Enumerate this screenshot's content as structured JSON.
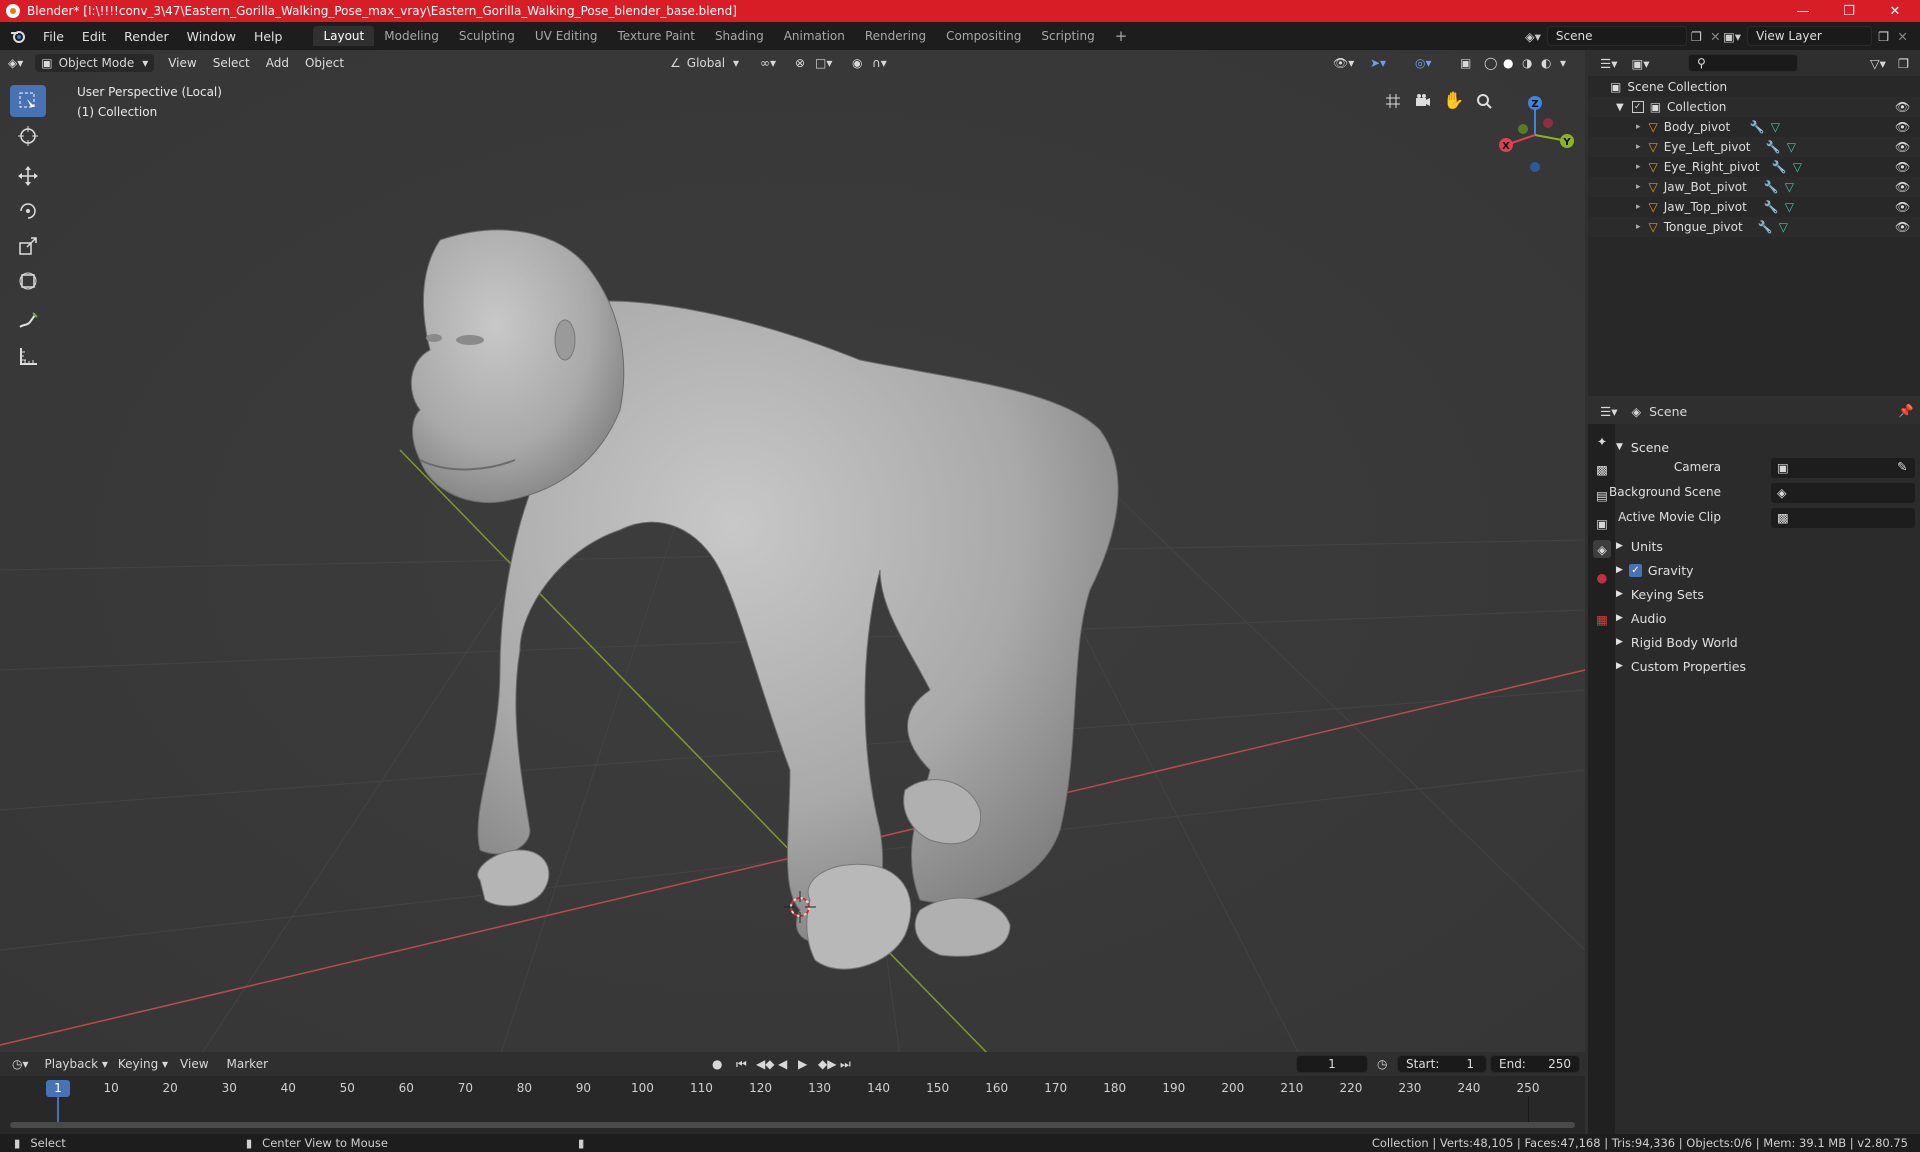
{
  "window": {
    "title": "Blender* [I:\\!!!!conv_3\\47\\Eastern_Gorilla_Walking_Pose_max_vray\\Eastern_Gorilla_Walking_Pose_blender_base.blend]"
  },
  "menu": [
    "File",
    "Edit",
    "Render",
    "Window",
    "Help"
  ],
  "workspaces": [
    "Layout",
    "Modeling",
    "Sculpting",
    "UV Editing",
    "Texture Paint",
    "Shading",
    "Animation",
    "Rendering",
    "Compositing",
    "Scripting"
  ],
  "active_workspace": "Layout",
  "scene_field": "Scene",
  "view_layer_field": "View Layer",
  "viewport": {
    "mode": "Object Mode",
    "menus": [
      "View",
      "Select",
      "Add",
      "Object"
    ],
    "transform_orientation": "Global",
    "perspective_label": "User Perspective (Local)",
    "collection_label": "(1) Collection",
    "gizmo": {
      "x": "X",
      "y": "Y",
      "z": "Z"
    }
  },
  "outliner": {
    "root": "Scene Collection",
    "collection": "Collection",
    "objects": [
      "Body_pivot",
      "Eye_Left_pivot",
      "Eye_Right_pivot",
      "Jaw_Bot_pivot",
      "Jaw_Top_pivot",
      "Tongue_pivot"
    ]
  },
  "properties": {
    "header": "Scene",
    "panel": "Scene",
    "camera_label": "Camera",
    "background_scene_label": "Background Scene",
    "active_movie_clip_label": "Active Movie Clip",
    "sections": [
      "Units",
      "Gravity",
      "Keying Sets",
      "Audio",
      "Rigid Body World",
      "Custom Properties"
    ],
    "gravity_checked": true
  },
  "timeline": {
    "menus": [
      "Playback",
      "Keying",
      "View",
      "Marker"
    ],
    "current_frame": "1",
    "start_label": "Start:",
    "start": "1",
    "end_label": "End:",
    "end": "250",
    "ruler": [
      "1",
      "10",
      "20",
      "30",
      "40",
      "50",
      "60",
      "70",
      "80",
      "90",
      "100",
      "110",
      "120",
      "130",
      "140",
      "150",
      "160",
      "170",
      "180",
      "190",
      "200",
      "210",
      "220",
      "230",
      "240",
      "250"
    ]
  },
  "status": {
    "select": "Select",
    "center_view": "Center View to Mouse",
    "stats": "Collection | Verts:48,105 | Faces:47,168 | Tris:94,336 | Objects:0/6 | Mem: 39.1 MB | v2.80.75"
  },
  "colors": {
    "accent": "#4772b3",
    "title_bar": "#d91d26",
    "x_axis": "#e04050",
    "y_axis": "#8bb325",
    "z_axis": "#3d85e0"
  }
}
